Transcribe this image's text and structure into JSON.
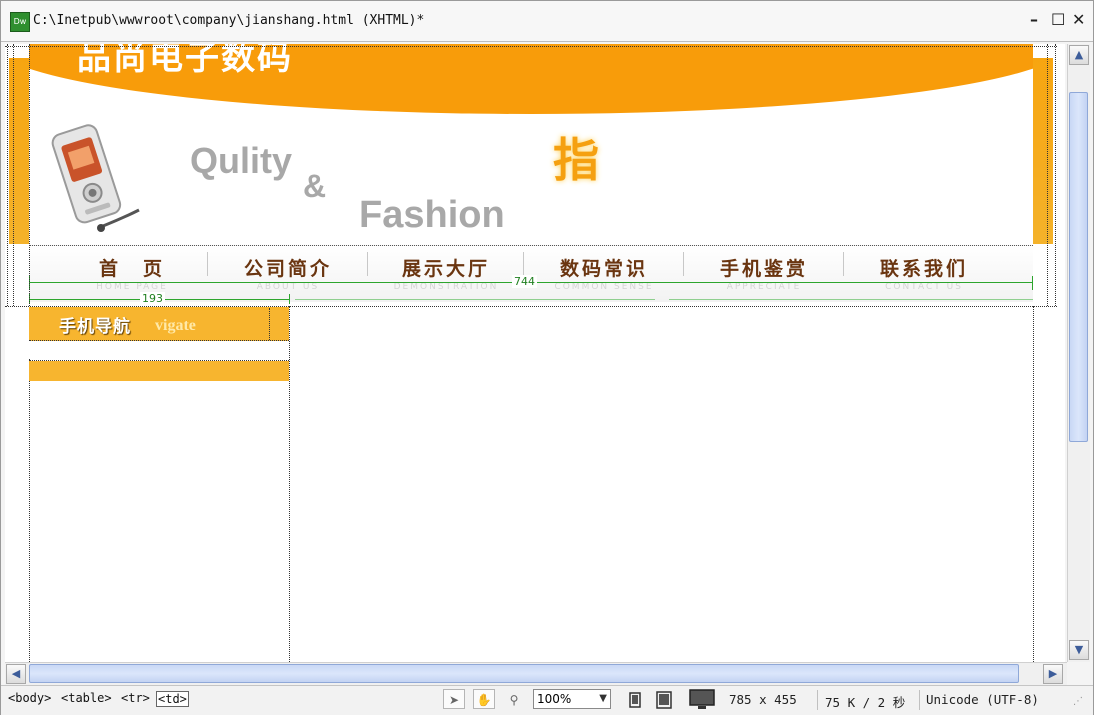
{
  "window": {
    "title": "C:\\Inetpub\\wwwroot\\company\\jianshang.html (XHTML)*",
    "app_icon_label": "Dw",
    "controls": {
      "minimize": "–",
      "maximize": "☐",
      "close": "✕"
    }
  },
  "banner": {
    "brand": "品尚电子数码",
    "tagline_1": "Qulity",
    "tagline_amp": "&",
    "tagline_2": "Fashion",
    "accent_char": "指"
  },
  "nav": {
    "items": [
      {
        "cn": "首　页",
        "en": "HOME PAGE"
      },
      {
        "cn": "公司简介",
        "en": "ABOUT US"
      },
      {
        "cn": "展示大厅",
        "en": "DEMONSTRATION"
      },
      {
        "cn": "数码常识",
        "en": "COMMON SENSE"
      },
      {
        "cn": "手机鉴赏",
        "en": "APPRECIATE"
      },
      {
        "cn": "联系我们",
        "en": "CONTACT US"
      }
    ]
  },
  "guides": {
    "table_width": "744",
    "cell_width": "193"
  },
  "sidebar": {
    "heading_cn": "手机导航",
    "heading_en": "vigate"
  },
  "status_bar": {
    "tags": [
      "<body>",
      "<table>",
      "<tr>",
      "<td>"
    ],
    "zoom": "100%",
    "window_size": "785 x 455",
    "download": "75 K / 2 秒",
    "encoding": "Unicode (UTF-8)"
  },
  "colors": {
    "accent_orange": "#f89c0a",
    "menu_orange": "#f7b52f",
    "nav_text": "#6a3510",
    "guide_green": "#2da52d"
  }
}
